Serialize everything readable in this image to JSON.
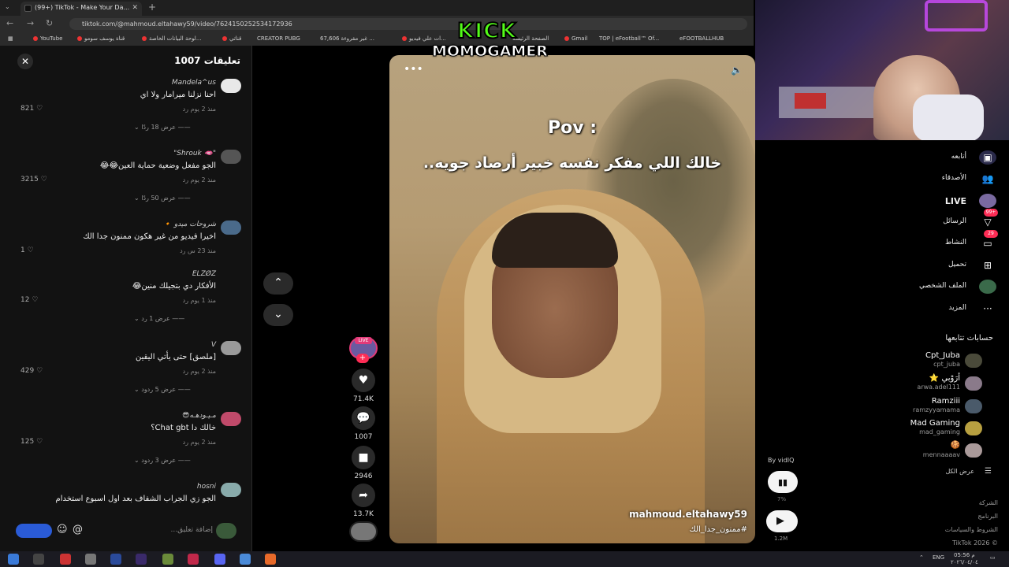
{
  "browser": {
    "tab_title": "(99+) TikTok - Make Your Da...",
    "tab_close": "✕",
    "new_tab": "+",
    "url": "tiktok.com/@mahmoud.eltahawy59/video/7624150252534172936",
    "bookmarks": [
      "YouTube",
      "قناة يوسف سومو",
      "لوحة البيانات الخاصة...",
      "قناتي",
      "CREATOR PUBG",
      "67,606 غير مقروءة ...",
      "ات علي فيديو...",
      "الصفحة الرئيسة",
      "Gmail",
      "TOP | eFootball™ Of...",
      "eFOOTBALLHUB"
    ]
  },
  "overlay": {
    "kick_line1": "KICK",
    "kick_line2": "MOMOGAMER"
  },
  "comments": {
    "title": "تعليقات 1007",
    "close": "✕",
    "items": [
      {
        "name": "Mandela^us",
        "text": "احنا نزلنا ميرامار ولا اي",
        "meta": "منذ 2 يوم     رد",
        "likes": "821",
        "replies": "عرض 18 ردًا"
      },
      {
        "name": "\"🫦 Shrouk\"",
        "text": "الجو مفعل وضعية حماية العين😂😂",
        "meta": "منذ 2 يوم     رد",
        "likes": "3215",
        "replies": "عرض 50 ردًا"
      },
      {
        "name": "شروحات ميدو 🔸",
        "text": "اخيرا فيديو من غير هكون ممنون جدا الك",
        "meta": "منذ 23 س     رد",
        "likes": "1",
        "replies": ""
      },
      {
        "name": "ELZØZ",
        "text": "الأفكار دي بتجيلك منين😂",
        "meta": "منذ 1 يوم     رد",
        "likes": "12",
        "replies": "عرض 1 رد"
      },
      {
        "name": "V",
        "text": "[ملصق] حتى يأتي اليقين",
        "meta": "منذ 2 يوم     رد",
        "likes": "429",
        "replies": "عرض 5 ردود"
      },
      {
        "name": "مـيـودهـه😎",
        "text": "خالك دا Chat gbt؟",
        "meta": "منذ 2 يوم     رد",
        "likes": "125",
        "replies": "عرض 3 ردود"
      },
      {
        "name": "hosni",
        "text": "الجو زي الجراب الشفاف بعد اول اسبوع استخدام",
        "meta": "",
        "likes": "",
        "replies": ""
      }
    ],
    "input_placeholder": "إضافة تعليق..."
  },
  "video": {
    "pov": "Pov :",
    "caption": "خالك اللي مفكر نفسه خبير أرصاد جويه..",
    "author": "mahmoud.eltahawy59",
    "tag": "#ممنون_جدا_الك",
    "more": "•••"
  },
  "actions": {
    "live_badge": "LIVE",
    "plus": "+",
    "likes": "71.4K",
    "comments": "1007",
    "saves": "2946",
    "shares": "13.7K"
  },
  "sidebar": {
    "nav": [
      {
        "label": "أتابعه"
      },
      {
        "label": "الأصدقاء"
      },
      {
        "label": "LIVE"
      },
      {
        "label": "الرسائل",
        "badge": "99+"
      },
      {
        "label": "النشاط",
        "badge": "29"
      },
      {
        "label": "تحميل"
      },
      {
        "label": "الملف الشخصي"
      },
      {
        "label": "المزيد"
      }
    ],
    "following_header": "حسابات تتابعها",
    "following": [
      {
        "name": "Cpt_Juba",
        "user": "cpt_juba"
      },
      {
        "name": "أرَوْبي ⭐",
        "user": "arwa.adel111"
      },
      {
        "name": "Ramziii",
        "user": "ramzyyamama"
      },
      {
        "name": "Mad Gaming",
        "user": "mad_gaming"
      },
      {
        "name": "🍪",
        "user": "mennaaaav"
      }
    ],
    "show_all": "عرض الكل",
    "footer": [
      "الشركة",
      "البرنامج",
      "الشروط والسياسات",
      "© 2026 TikTok"
    ]
  },
  "vidiq": {
    "label": "By vidIQ",
    "pct": "7%",
    "views": "1.2M"
  },
  "taskbar": {
    "lang": "ENG",
    "time": "05:56 م",
    "date": "٢٠٢٦/٠٤/٠٤"
  }
}
